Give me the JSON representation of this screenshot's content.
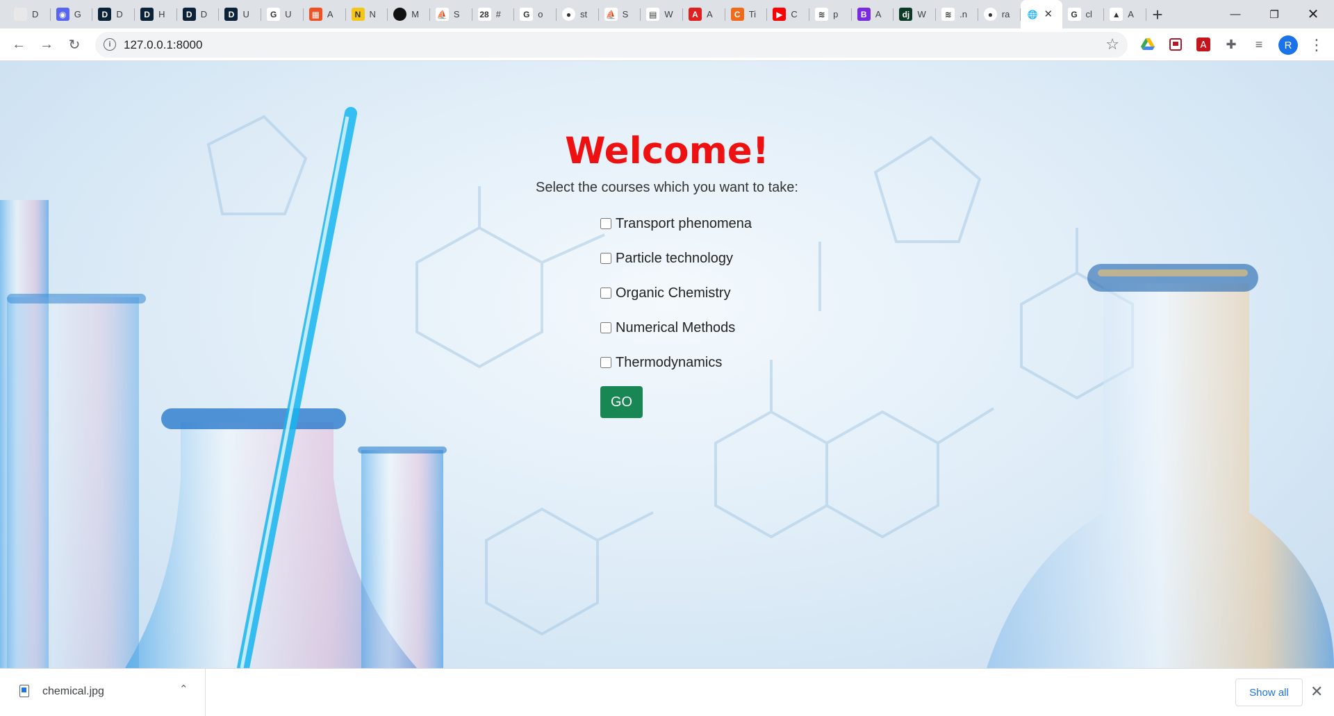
{
  "browser": {
    "tabs": [
      {
        "text": "D",
        "fav_color": "#e8e8e8",
        "fav_glyph": "",
        "icon": "generic-page-icon"
      },
      {
        "text": "G",
        "fav_color": "#5865f2",
        "fav_glyph": "◉",
        "icon": "discord-icon"
      },
      {
        "text": "D",
        "fav_color": "#0b2239",
        "fav_glyph": "D",
        "icon": "d-logo-icon"
      },
      {
        "text": "H",
        "fav_color": "#0b2239",
        "fav_glyph": "D",
        "icon": "d-logo-icon"
      },
      {
        "text": "D",
        "fav_color": "#0b2239",
        "fav_glyph": "D",
        "icon": "d-logo-icon"
      },
      {
        "text": "U",
        "fav_color": "#0b2239",
        "fav_glyph": "D",
        "icon": "d-logo-icon"
      },
      {
        "text": "U",
        "fav_color": "#ffffff",
        "fav_glyph": "G",
        "icon": "google-icon"
      },
      {
        "text": "A",
        "fav_color": "#f25022",
        "fav_glyph": "▦",
        "icon": "microsoft-icon"
      },
      {
        "text": "N",
        "fav_color": "#f5c518",
        "fav_glyph": "N",
        "icon": "n-logo-icon"
      },
      {
        "text": "M",
        "fav_color": "#111111",
        "fav_glyph": "",
        "icon": "medium-icon"
      },
      {
        "text": "S",
        "fav_color": "#ffffff",
        "fav_glyph": "⛵",
        "icon": "streamlit-icon"
      },
      {
        "text": "#",
        "fav_color": "#ffffff",
        "fav_glyph": "28",
        "icon": "calendar-icon"
      },
      {
        "text": "o",
        "fav_color": "#ffffff",
        "fav_glyph": "G",
        "icon": "google-icon"
      },
      {
        "text": "st",
        "fav_color": "#ffffff",
        "fav_glyph": "●",
        "icon": "github-icon"
      },
      {
        "text": "S",
        "fav_color": "#ffffff",
        "fav_glyph": "⛵",
        "icon": "streamlit-icon"
      },
      {
        "text": "W",
        "fav_color": "#ffffff",
        "fav_glyph": "▤",
        "icon": "w-logo-icon"
      },
      {
        "text": "A",
        "fav_color": "#e02020",
        "fav_glyph": "A",
        "icon": "adobe-icon"
      },
      {
        "text": "Ti",
        "fav_color": "#f06a1a",
        "fav_glyph": "C",
        "icon": "c-logo-icon"
      },
      {
        "text": "C",
        "fav_color": "#ff0000",
        "fav_glyph": "▶",
        "icon": "youtube-icon"
      },
      {
        "text": "p",
        "fav_color": "#ffffff",
        "fav_glyph": "≋",
        "icon": "stackoverflow-icon"
      },
      {
        "text": "A",
        "fav_color": "#7a2be2",
        "fav_glyph": "B",
        "icon": "bootstrap-icon"
      },
      {
        "text": "W",
        "fav_color": "#0c3c26",
        "fav_glyph": "dj",
        "icon": "django-icon"
      },
      {
        "text": ".n",
        "fav_color": "#ffffff",
        "fav_glyph": "≋",
        "icon": "stackoverflow-icon"
      },
      {
        "text": "ra",
        "fav_color": "#ffffff",
        "fav_glyph": "●",
        "icon": "github-icon"
      },
      {
        "text": "",
        "fav_color": "#ffffff",
        "fav_glyph": "🌐",
        "icon": "globe-icon",
        "active": true
      },
      {
        "text": "cl",
        "fav_color": "#ffffff",
        "fav_glyph": "G",
        "icon": "google-icon"
      },
      {
        "text": "A",
        "fav_color": "#ffffff",
        "fav_glyph": "▲",
        "icon": "azure-icon"
      }
    ],
    "url": "127.0.0.1:8000",
    "profile_initial": "R"
  },
  "page": {
    "title": "Welcome!",
    "subtitle": "Select the courses which you want to take:",
    "courses": [
      {
        "label": "Transport phenomena",
        "checked": false
      },
      {
        "label": "Particle technology",
        "checked": false
      },
      {
        "label": "Organic Chemistry",
        "checked": false
      },
      {
        "label": "Numerical Methods",
        "checked": false
      },
      {
        "label": "Thermodynamics",
        "checked": false
      }
    ],
    "submit_label": "GO",
    "accent_color": "#198754",
    "title_color": "#ee1111"
  },
  "downloads": {
    "file_name": "chemical.jpg",
    "show_all_label": "Show all"
  }
}
